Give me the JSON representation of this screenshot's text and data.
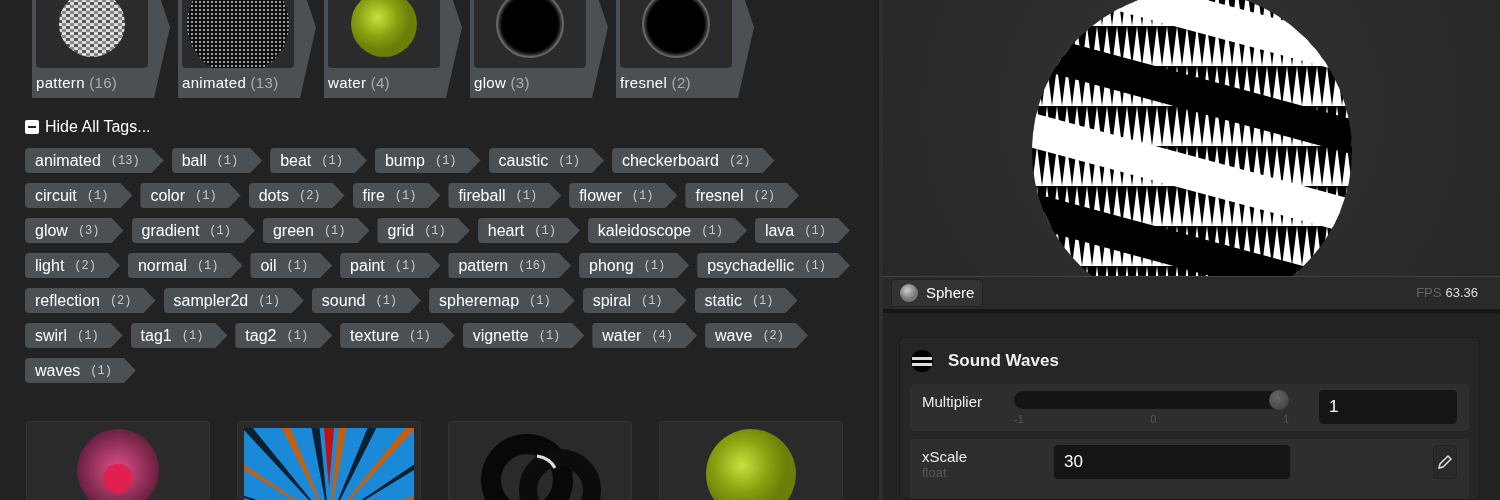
{
  "categories": [
    {
      "name": "pattern",
      "count": "(16)",
      "kind": "checker"
    },
    {
      "name": "animated",
      "count": "(13)",
      "kind": "dots"
    },
    {
      "name": "water",
      "count": "(4)",
      "kind": "swirl"
    },
    {
      "name": "glow",
      "count": "(3)",
      "kind": "black"
    },
    {
      "name": "fresnel",
      "count": "(2)",
      "kind": "black"
    }
  ],
  "tags_toggle": "Hide All Tags...",
  "tags": [
    {
      "name": "animated",
      "count": "(13)"
    },
    {
      "name": "ball",
      "count": "(1)"
    },
    {
      "name": "beat",
      "count": "(1)"
    },
    {
      "name": "bump",
      "count": "(1)"
    },
    {
      "name": "caustic",
      "count": "(1)"
    },
    {
      "name": "checkerboard",
      "count": "(2)"
    },
    {
      "name": "circuit",
      "count": "(1)"
    },
    {
      "name": "color",
      "count": "(1)"
    },
    {
      "name": "dots",
      "count": "(2)"
    },
    {
      "name": "fire",
      "count": "(1)"
    },
    {
      "name": "fireball",
      "count": "(1)"
    },
    {
      "name": "flower",
      "count": "(1)"
    },
    {
      "name": "fresnel",
      "count": "(2)"
    },
    {
      "name": "glow",
      "count": "(3)"
    },
    {
      "name": "gradient",
      "count": "(1)"
    },
    {
      "name": "green",
      "count": "(1)"
    },
    {
      "name": "grid",
      "count": "(1)"
    },
    {
      "name": "heart",
      "count": "(1)"
    },
    {
      "name": "kaleidoscope",
      "count": "(1)"
    },
    {
      "name": "lava",
      "count": "(1)"
    },
    {
      "name": "light",
      "count": "(2)"
    },
    {
      "name": "normal",
      "count": "(1)"
    },
    {
      "name": "oil",
      "count": "(1)"
    },
    {
      "name": "paint",
      "count": "(1)"
    },
    {
      "name": "pattern",
      "count": "(16)"
    },
    {
      "name": "phong",
      "count": "(1)"
    },
    {
      "name": "psychadellic",
      "count": "(1)"
    },
    {
      "name": "reflection",
      "count": "(2)"
    },
    {
      "name": "sampler2d",
      "count": "(1)"
    },
    {
      "name": "sound",
      "count": "(1)"
    },
    {
      "name": "spheremap",
      "count": "(1)"
    },
    {
      "name": "spiral",
      "count": "(1)"
    },
    {
      "name": "static",
      "count": "(1)"
    },
    {
      "name": "swirl",
      "count": "(1)"
    },
    {
      "name": "tag1",
      "count": "(1)"
    },
    {
      "name": "tag2",
      "count": "(1)"
    },
    {
      "name": "texture",
      "count": "(1)"
    },
    {
      "name": "vignette",
      "count": "(1)"
    },
    {
      "name": "water",
      "count": "(4)"
    },
    {
      "name": "wave",
      "count": "(2)"
    },
    {
      "name": "waves",
      "count": "(1)"
    }
  ],
  "thumbnails": [
    {
      "kind": "heart"
    },
    {
      "kind": "rays"
    },
    {
      "kind": "rings"
    },
    {
      "kind": "swirl"
    }
  ],
  "preview_bar": {
    "model_button": "Sphere",
    "fps_label": "FPS",
    "fps_value": "63.36"
  },
  "shader_panel": {
    "title": "Sound Waves",
    "params": [
      {
        "kind": "slider",
        "label": "Multiplier",
        "level": 1,
        "ticks": [
          "-1",
          "0",
          "1"
        ],
        "value": "1"
      },
      {
        "kind": "text",
        "label": "xScale",
        "type": "float",
        "value": "30"
      }
    ]
  }
}
